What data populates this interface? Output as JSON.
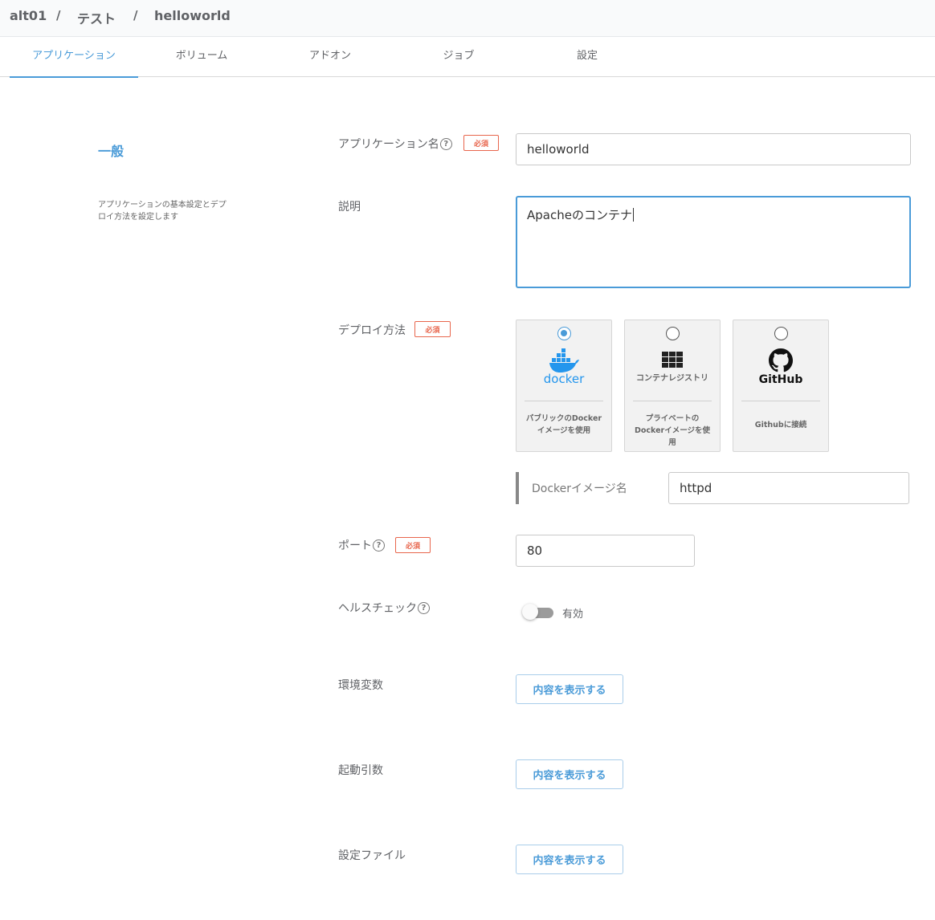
{
  "breadcrumb": {
    "items": [
      "alt01",
      "テスト",
      "helloworld"
    ],
    "separator": "/"
  },
  "tabs": [
    {
      "label": "アプリケーション",
      "active": true
    },
    {
      "label": "ボリューム",
      "active": false
    },
    {
      "label": "アドオン",
      "active": false
    },
    {
      "label": "ジョブ",
      "active": false
    },
    {
      "label": "設定",
      "active": false
    }
  ],
  "section": {
    "title": "一般",
    "description": "アプリケーションの基本設定とデプロイ方法を設定します"
  },
  "form": {
    "required_badge": "必須",
    "help_glyph": "?",
    "app_name": {
      "label": "アプリケーション名",
      "value": "helloworld"
    },
    "description": {
      "label": "説明",
      "value": "Apacheのコンテナ"
    },
    "deploy": {
      "label": "デプロイ方法",
      "options": [
        {
          "logo": "docker",
          "description": "パブリックのDockerイメージを使用",
          "selected": true,
          "icon": "docker-whale-icon"
        },
        {
          "logo": "コンテナレジストリ",
          "description": "プライベートのDockerイメージを使用",
          "selected": false,
          "icon": "container-registry-grid-icon"
        },
        {
          "logo": "GitHub",
          "description": "Githubに接続",
          "selected": false,
          "icon": "github-octocat-icon"
        }
      ],
      "image_label": "Dockerイメージ名",
      "image_value": "httpd"
    },
    "port": {
      "label": "ポート",
      "value": "80"
    },
    "healthcheck": {
      "label": "ヘルスチェック",
      "toggle_label": "有効",
      "enabled": false
    },
    "env": {
      "label": "環境変数",
      "button": "内容を表示する"
    },
    "args": {
      "label": "起動引数",
      "button": "内容を表示する"
    },
    "config": {
      "label": "設定ファイル",
      "button": "内容を表示する"
    }
  },
  "colors": {
    "accent": "#4a9bd8",
    "required": "#e8664d",
    "docker": "#2496ed"
  }
}
